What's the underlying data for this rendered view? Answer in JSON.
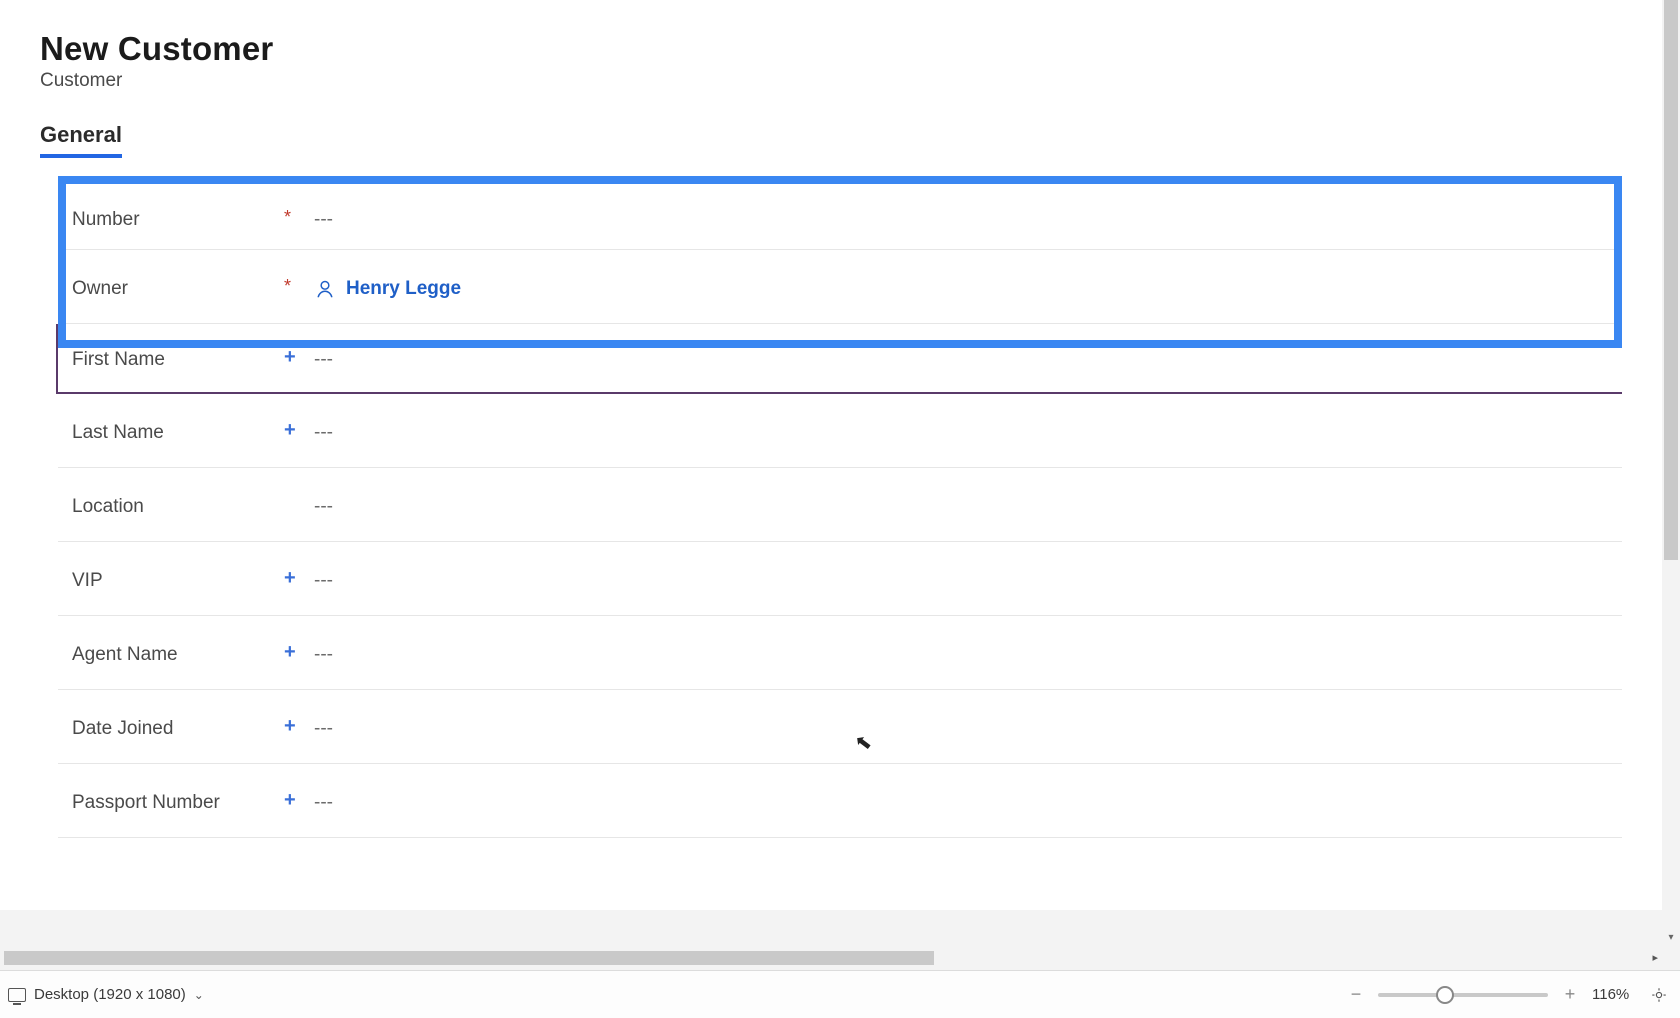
{
  "header": {
    "title": "New Customer",
    "subtitle": "Customer"
  },
  "tabs": {
    "general": "General"
  },
  "fields": {
    "number": {
      "label": "Number",
      "marker": "*",
      "marker_class": "marker-red",
      "value": "---"
    },
    "owner": {
      "label": "Owner",
      "marker": "*",
      "marker_class": "marker-red",
      "value": "Henry Legge"
    },
    "first": {
      "label": "First Name",
      "marker": "+",
      "marker_class": "marker-blue",
      "value": "---"
    },
    "last": {
      "label": "Last Name",
      "marker": "+",
      "marker_class": "marker-blue",
      "value": "---"
    },
    "location": {
      "label": "Location",
      "marker": "",
      "marker_class": "",
      "value": "---"
    },
    "vip": {
      "label": "VIP",
      "marker": "+",
      "marker_class": "marker-blue",
      "value": "---"
    },
    "agent": {
      "label": "Agent Name",
      "marker": "+",
      "marker_class": "marker-blue",
      "value": "---"
    },
    "date": {
      "label": "Date Joined",
      "marker": "+",
      "marker_class": "marker-blue",
      "value": "---"
    },
    "passport": {
      "label": "Passport Number",
      "marker": "+",
      "marker_class": "marker-blue",
      "value": "---"
    }
  },
  "footer": {
    "device_label": "Desktop (1920 x 1080)",
    "zoom_label": "116%"
  }
}
